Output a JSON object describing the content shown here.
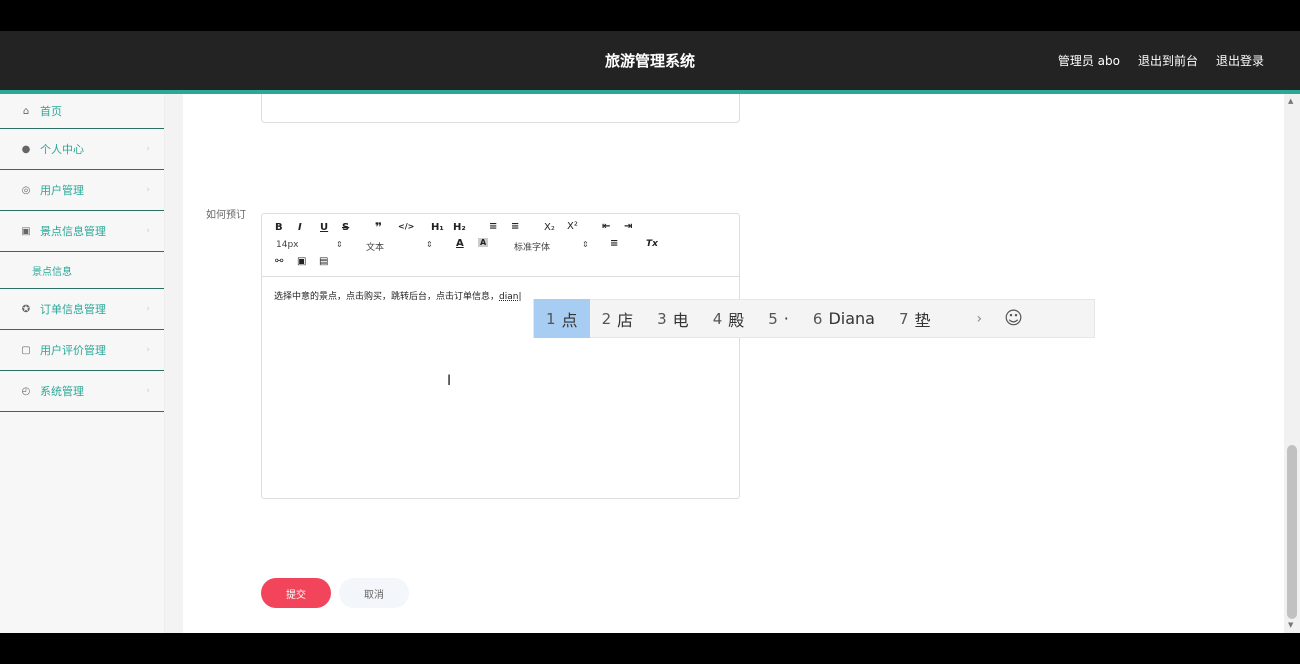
{
  "header": {
    "title": "旅游管理系统",
    "admin_label": "管理员 abo",
    "to_frontend": "退出到前台",
    "logout": "退出登录"
  },
  "sidebar": {
    "items": [
      {
        "label": "首页",
        "icon": "home-icon"
      },
      {
        "label": "个人中心",
        "icon": "user-icon"
      },
      {
        "label": "用户管理",
        "icon": "users-icon"
      },
      {
        "label": "景点信息管理",
        "icon": "location-icon"
      },
      {
        "label": "订单信息管理",
        "icon": "order-icon"
      },
      {
        "label": "用户评价管理",
        "icon": "comment-icon"
      },
      {
        "label": "系统管理",
        "icon": "settings-icon"
      }
    ],
    "sub_item": "景点信息"
  },
  "form": {
    "field_label": "如何预订",
    "editor_text": "选择中意的景点，点击购买，跳转后台，点击订单信息，",
    "composing_text": "dian"
  },
  "toolbar": {
    "bold": "B",
    "italic": "I",
    "underline": "U",
    "strike": "S",
    "quote": "❞",
    "code": "</>",
    "h1": "H₁",
    "h2": "H₂",
    "ordered_list": "≡",
    "bullet_list": "≡",
    "subscript": "X₂",
    "superscript": "X²",
    "outdent": "⇤",
    "indent": "⇥",
    "size": "14px",
    "block": "文本",
    "font_color": "A",
    "bg_color": "A",
    "font_family": "标准字体",
    "align": "≡",
    "clean": "Tx"
  },
  "ime": {
    "candidates": [
      {
        "num": "1",
        "text": "点"
      },
      {
        "num": "2",
        "text": "店"
      },
      {
        "num": "3",
        "text": "电"
      },
      {
        "num": "4",
        "text": "殿"
      },
      {
        "num": "5",
        "text": "·"
      },
      {
        "num": "6",
        "text": "Diana"
      },
      {
        "num": "7",
        "text": "垫"
      }
    ]
  },
  "buttons": {
    "submit": "提交",
    "cancel": "取消"
  },
  "colors": {
    "accent": "#2aa898",
    "header_bg": "#232323",
    "submit_bg": "#f2455b"
  }
}
